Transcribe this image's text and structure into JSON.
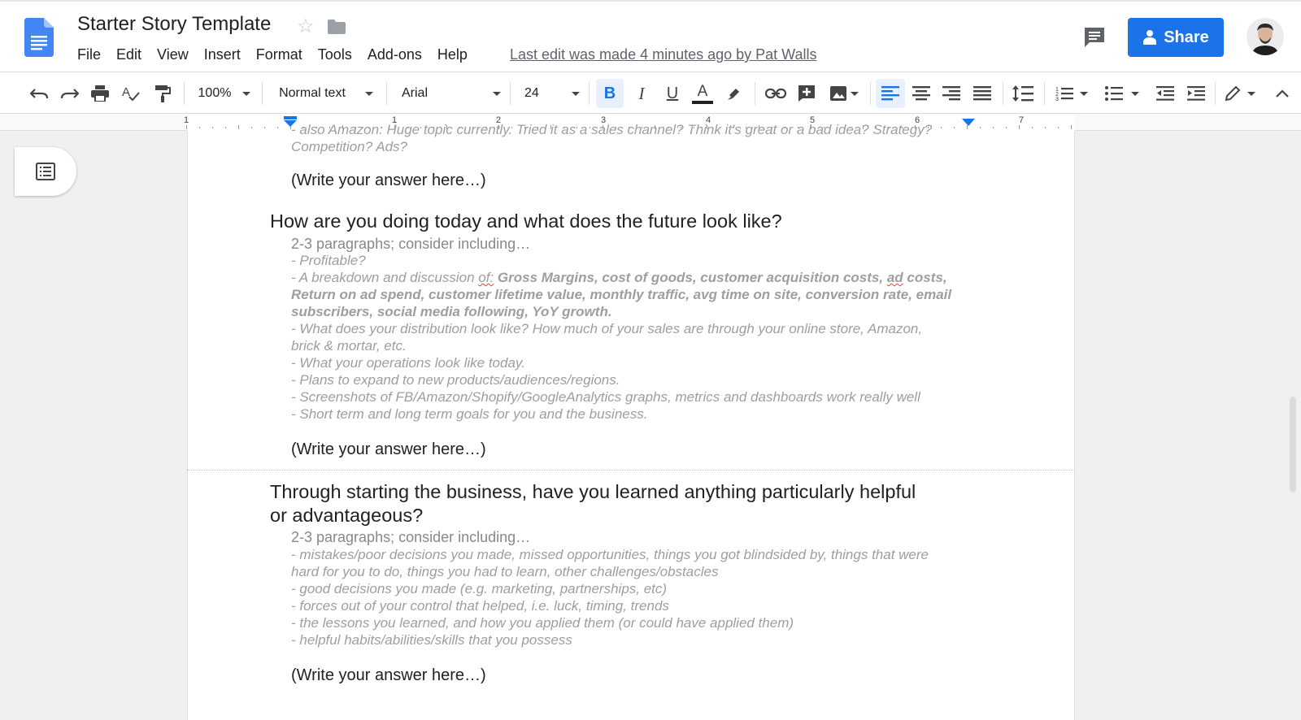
{
  "header": {
    "title": "Starter Story Template",
    "menu": [
      "File",
      "Edit",
      "View",
      "Insert",
      "Format",
      "Tools",
      "Add-ons",
      "Help"
    ],
    "last_edit": "Last edit was made 4 minutes ago by Pat Walls",
    "share_label": "Share",
    "colors": {
      "accent": "#1a73e8",
      "doc_blue": "#4285f4"
    }
  },
  "toolbar": {
    "zoom": "100%",
    "style": "Normal text",
    "font": "Arial",
    "size": "24"
  },
  "ruler": {
    "numbers": [
      "1",
      "1",
      "2",
      "3",
      "4",
      "5",
      "6",
      "7"
    ]
  },
  "doc": {
    "top_line1": "- also Amazon: Huge topic currently. Tried it as a sales channel? Think it's great or a bad idea? Strategy?",
    "top_line2": "Competition? Ads?",
    "answer1": "(Write your answer here…)",
    "h_today": "How are you doing today and what does the future look like?",
    "sub1": "2-3 paragraphs; consider including…",
    "b_profitable": "- Profitable?",
    "b_breakdown_pre": "- A breakdown and discussion ",
    "b_breakdown_of": "of:",
    "b_breakdown_bold1": "Gross Margins, cost of goods, customer acquisition costs,",
    "b_breakdown_ad": "ad",
    "b_breakdown_bold2": "costs,",
    "b_line2": "Return on ad spend, customer lifetime value, monthly traffic, avg time on site, conversion rate, email",
    "b_line3": "subscribers, social media following, YoY growth.",
    "b_dist1": "- What does your distribution look like? How much of your sales are through your online store, Amazon,",
    "b_dist2": "brick & mortar, etc.",
    "b_ops": "- What your operations look like today.",
    "b_plans": "- Plans to expand to new products/audiences/regions.",
    "b_screens": "- Screenshots of FB/Amazon/Shopify/GoogleAnalytics graphs, metrics and dashboards work really well",
    "b_goals": "- Short term and long term goals for you and the business.",
    "answer2": "(Write your answer here…)",
    "h_learned1": "Through starting the business, have you learned anything particularly helpful",
    "h_learned2": "or advantageous?",
    "sub2": "2-3 paragraphs; consider including…",
    "c_mistakes1": "- mistakes/poor decisions you made, missed opportunities, things you got blindsided by, things that were",
    "c_mistakes2": "hard for you to do, things you had to learn, other challenges/obstacles",
    "c_good": "- good decisions you made (e.g. marketing, partnerships, etc)",
    "c_forces": "- forces out of your control that helped, i.e. luck, timing, trends",
    "c_lessons": "- the lessons you learned, and how you applied them (or could have applied them)",
    "c_habits": "- helpful habits/abilities/skills that you possess",
    "answer3": "(Write your answer here…)"
  }
}
